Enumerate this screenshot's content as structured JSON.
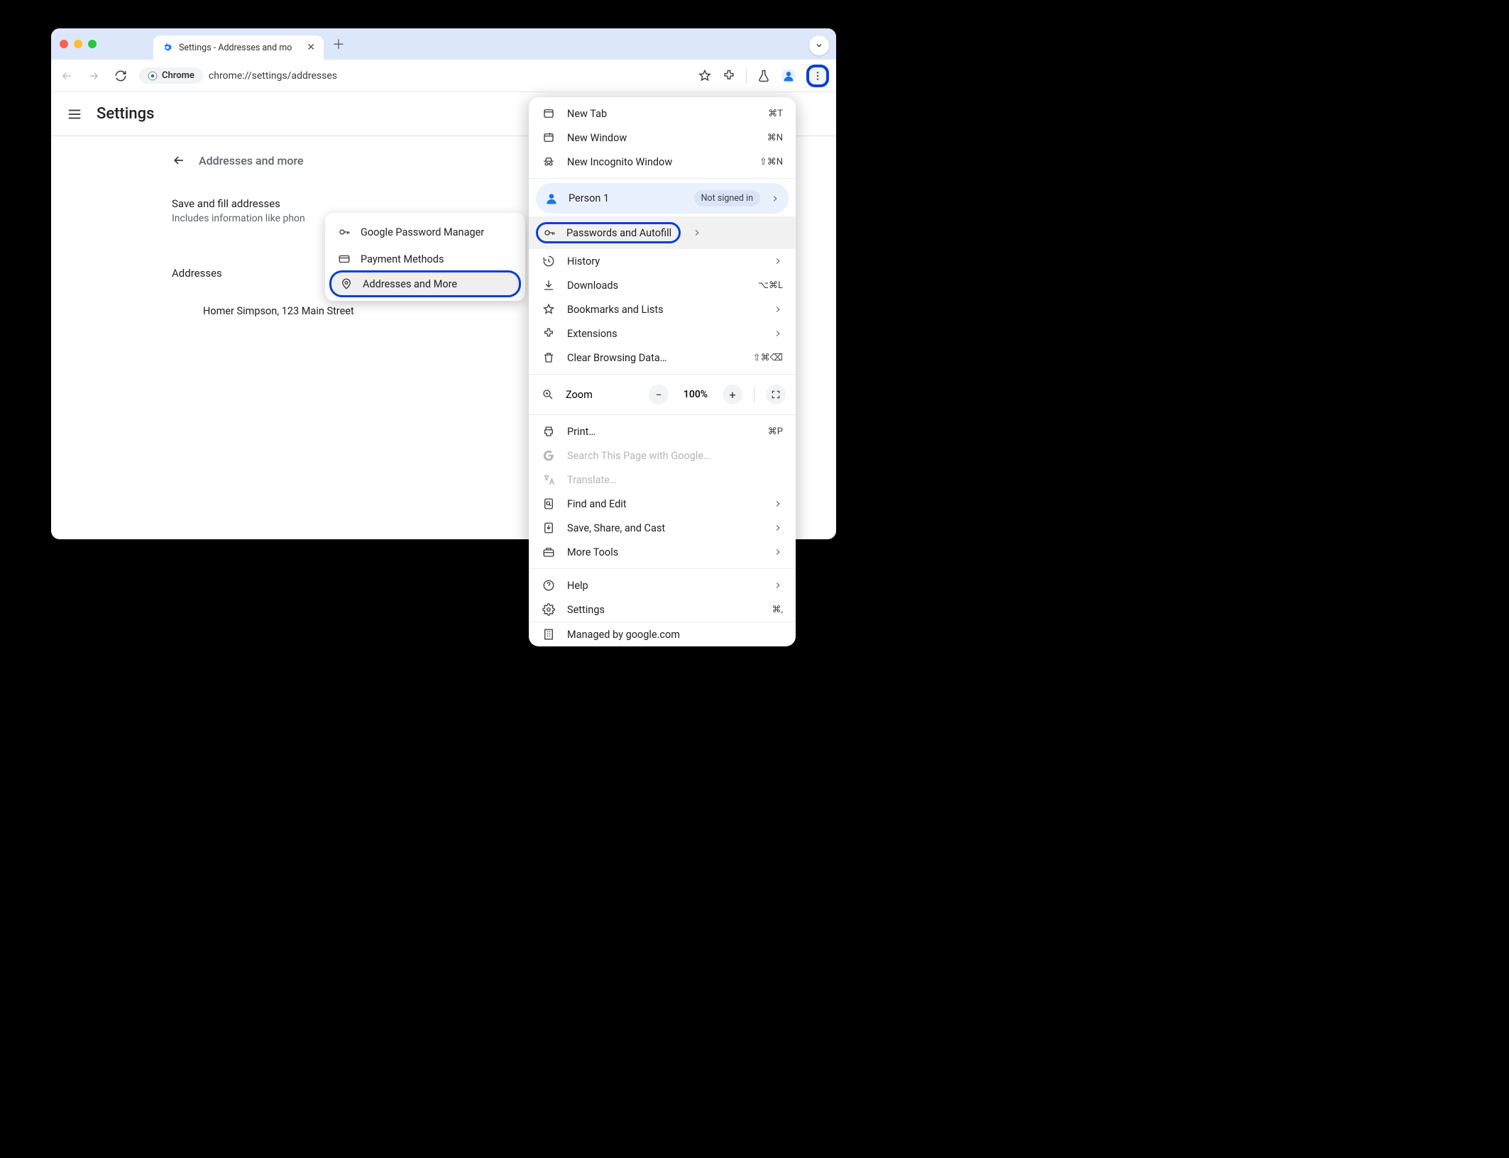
{
  "tab": {
    "title": "Settings - Addresses and mo"
  },
  "omnibox": {
    "chip": "Chrome",
    "url": "chrome://settings/addresses"
  },
  "header": {
    "title": "Settings"
  },
  "page": {
    "title": "Addresses and more",
    "save_fill_title": "Save and fill addresses",
    "save_fill_sub": "Includes information like phon",
    "addresses_label": "Addresses",
    "address_entry": "Homer Simpson, 123 Main Street"
  },
  "submenu": {
    "items": [
      "Google Password Manager",
      "Payment Methods",
      "Addresses and More"
    ]
  },
  "menu": {
    "new_tab": "New Tab",
    "new_tab_k": "⌘T",
    "new_window": "New Window",
    "new_window_k": "⌘N",
    "incognito": "New Incognito Window",
    "incognito_k": "⇧⌘N",
    "profile_name": "Person 1",
    "profile_badge": "Not signed in",
    "passwords": "Passwords and Autofill",
    "history": "History",
    "downloads": "Downloads",
    "downloads_k": "⌥⌘L",
    "bookmarks": "Bookmarks and Lists",
    "extensions": "Extensions",
    "clear": "Clear Browsing Data…",
    "clear_k": "⇧⌘⌫",
    "zoom": "Zoom",
    "zoom_pct": "100%",
    "print": "Print…",
    "print_k": "⌘P",
    "search_page": "Search This Page with Google…",
    "translate": "Translate…",
    "find_edit": "Find and Edit",
    "save_share": "Save, Share, and Cast",
    "more_tools": "More Tools",
    "help": "Help",
    "settings": "Settings",
    "settings_k": "⌘,",
    "managed": "Managed by google.com"
  }
}
